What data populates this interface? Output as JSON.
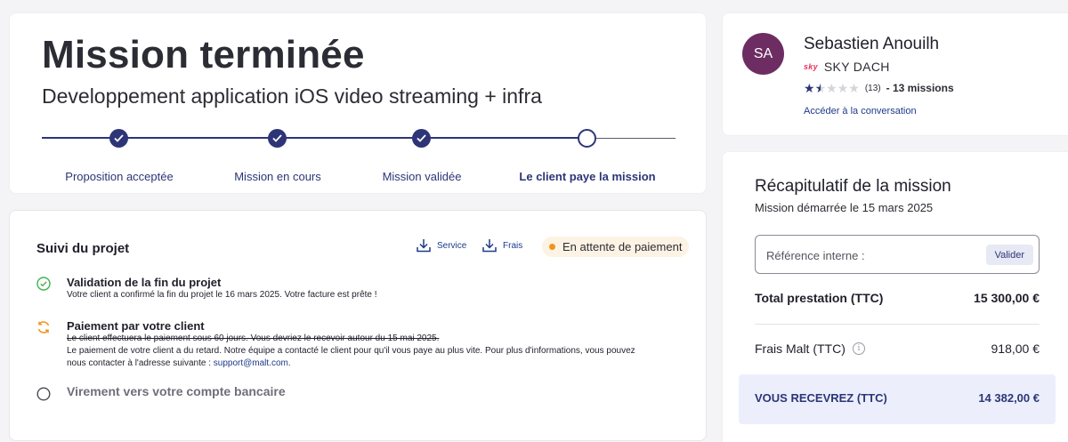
{
  "header": {
    "title": "Mission terminée",
    "subtitle": "Developpement application iOS video streaming + infra",
    "steps": [
      {
        "label": "Proposition acceptée",
        "state": "done"
      },
      {
        "label": "Mission en cours",
        "state": "done"
      },
      {
        "label": "Mission validée",
        "state": "done"
      },
      {
        "label": "Le client paye la mission",
        "state": "current"
      }
    ]
  },
  "tracking": {
    "title": "Suivi du projet",
    "downloads": [
      {
        "label": "Service",
        "icon": "download-icon"
      },
      {
        "label": "Frais",
        "icon": "download-icon"
      }
    ],
    "status_badge": "En attente de paiement",
    "items": [
      {
        "status": "done",
        "icon": "check-circle-icon",
        "title": "Validation de la fin du projet",
        "text": "Votre client a confirmé la fin du projet le 16 mars 2025. Votre facture est prête !"
      },
      {
        "status": "in-progress",
        "icon": "sync-icon",
        "title": "Paiement par votre client",
        "strike_text": "Le client effectuera le paiement sous 60 jours. Vous devriez le recevoir autour du 15 mai 2025.",
        "delay_text_1": "Le paiement de votre client a du retard. Notre équipe a contacté le client pour qu'il vous paye au plus vite. Pour plus d'informations, vous pouvez",
        "delay_text_2": "nous contacter à l'adresse suivante : ",
        "email": "support@malt.com",
        "after_email": "."
      },
      {
        "status": "pending",
        "icon": "empty-circle-icon",
        "title": "Virement vers votre compte bancaire"
      }
    ]
  },
  "client": {
    "initials": "SA",
    "name": "Sebastien Anouilh",
    "company_logo": "sky",
    "company": "SKY DACH",
    "rating": 1.5,
    "rating_max": 5,
    "review_count": "(13)",
    "missions": "- 13 missions",
    "conversation_link": "Accéder à la conversation"
  },
  "recap": {
    "title": "Récapitulatif de la mission",
    "subtitle": "Mission démarrée le 15 mars 2025",
    "reference_placeholder": "Référence interne :",
    "validate_label": "Valider",
    "total_label": "Total prestation (TTC)",
    "total_value": "15 300,00 €",
    "fees_label": "Frais Malt (TTC)",
    "fees_value": "918,00 €",
    "receive_label": "VOUS RECEVREZ (TTC)",
    "receive_value": "14 382,00 €"
  },
  "colors": {
    "accent": "#2d3577",
    "badge_bg": "#fdf3e4",
    "badge_dot": "#f0941a",
    "avatar": "#6d2d63",
    "success": "#3fb34f",
    "warning": "#f0941a",
    "receive_bg": "#eceffb"
  }
}
